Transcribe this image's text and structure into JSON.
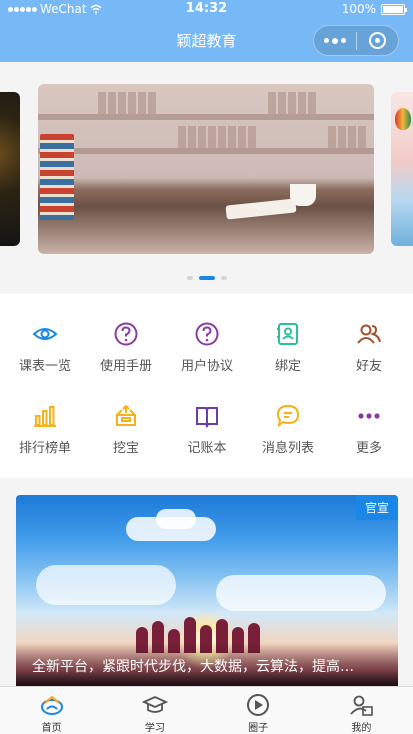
{
  "status_bar": {
    "carrier": "WeChat",
    "time": "14:32",
    "battery": "100%"
  },
  "nav": {
    "title": "颖超教育"
  },
  "carousel": {
    "slides": [
      "left",
      "books-shelf",
      "balloon"
    ],
    "active_index": 1,
    "count": 3
  },
  "grid": {
    "items": [
      {
        "label": "课表一览",
        "icon": "eye-icon",
        "color": "#1a87e6"
      },
      {
        "label": "使用手册",
        "icon": "question-circle-icon",
        "color": "#8a3aa8"
      },
      {
        "label": "用户协议",
        "icon": "question-circle-icon",
        "color": "#8a3aa8"
      },
      {
        "label": "绑定",
        "icon": "contact-book-icon",
        "color": "#2bbf9a"
      },
      {
        "label": "好友",
        "icon": "friends-icon",
        "color": "#a0522d"
      },
      {
        "label": "排行榜单",
        "icon": "bar-chart-icon",
        "color": "#f5b21b"
      },
      {
        "label": "挖宝",
        "icon": "treasure-box-icon",
        "color": "#f5b21b"
      },
      {
        "label": "记账本",
        "icon": "book-open-icon",
        "color": "#6a3da8"
      },
      {
        "label": "消息列表",
        "icon": "chat-bubble-icon",
        "color": "#f5b21b"
      },
      {
        "label": "更多",
        "icon": "more-dots-icon",
        "color": "#8a3aa8"
      }
    ]
  },
  "news_card": {
    "badge": "官宣",
    "caption": "全新平台，紧跟时代步伐，大数据，云算法，提高…"
  },
  "tabbar": {
    "items": [
      {
        "label": "首页",
        "icon": "home-logo-icon",
        "active": true
      },
      {
        "label": "学习",
        "icon": "graduation-cap-icon",
        "active": false
      },
      {
        "label": "圈子",
        "icon": "play-circle-icon",
        "active": false
      },
      {
        "label": "我的",
        "icon": "user-profile-icon",
        "active": false
      }
    ]
  }
}
